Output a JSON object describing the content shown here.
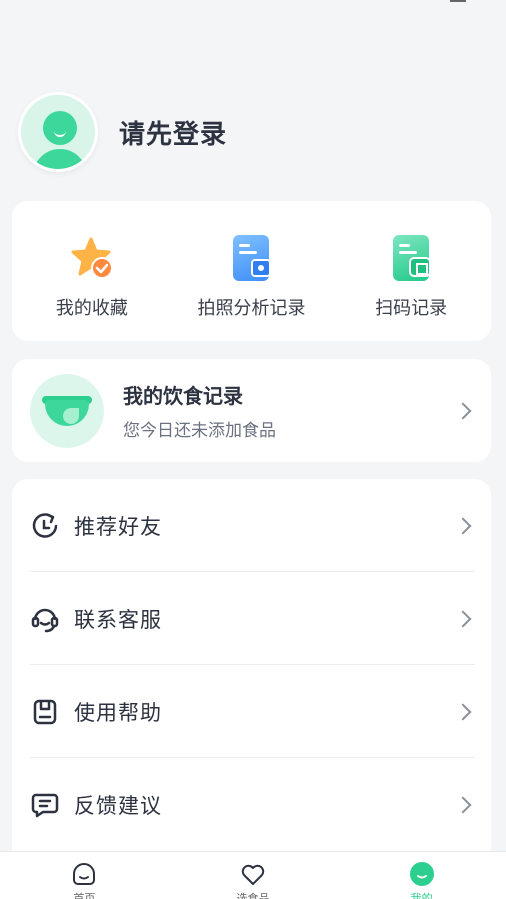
{
  "profile": {
    "login_prompt": "请先登录"
  },
  "quick_actions": [
    {
      "label": "我的收藏",
      "icon": "star-favorite-icon"
    },
    {
      "label": "拍照分析记录",
      "icon": "photo-analysis-doc-icon"
    },
    {
      "label": "扫码记录",
      "icon": "scan-record-doc-icon"
    }
  ],
  "diet_record": {
    "title": "我的饮食记录",
    "subtitle": "您今日还未添加食品"
  },
  "menu": [
    {
      "label": "推荐好友",
      "icon": "share-refresh-icon"
    },
    {
      "label": "联系客服",
      "icon": "headset-icon"
    },
    {
      "label": "使用帮助",
      "icon": "help-book-icon"
    },
    {
      "label": "反馈建议",
      "icon": "feedback-chat-icon"
    }
  ],
  "tabbar": [
    {
      "label": "首页",
      "icon": "home-face-icon",
      "active": false
    },
    {
      "label": "选食品",
      "icon": "heart-icon",
      "active": false
    },
    {
      "label": "我的",
      "icon": "profile-face-icon",
      "active": true
    }
  ],
  "colors": {
    "accent": "#2ccf8d",
    "background": "#f4f5f7"
  }
}
